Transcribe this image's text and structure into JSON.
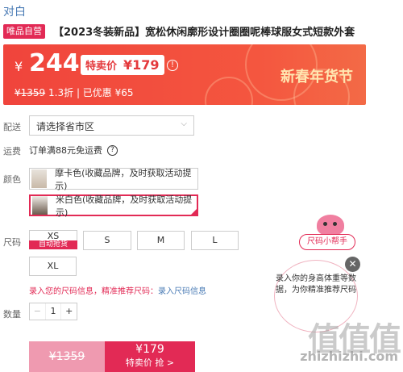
{
  "brand": "对白",
  "product": {
    "tag": "唯品自营",
    "title": "【2023冬装新品】宽松休闲廓形设计圈圈呢棒球服女式短款外套"
  },
  "price": {
    "currency": "¥",
    "current": "244",
    "special_label": "特卖价",
    "special_price": "¥179",
    "info_icon": "info-icon",
    "original": "¥1359",
    "discount": "1.3折",
    "saved": "已优惠 ¥65",
    "festival": "新春年货节"
  },
  "shipping": {
    "label": "配送",
    "placeholder": "请选择省市区",
    "fee_label": "运费",
    "fee_text": "订单满88元免运费"
  },
  "colors": {
    "label": "颜色",
    "options": [
      {
        "name": "摩卡色(收藏品牌，及时获取活动提示)",
        "selected": false
      },
      {
        "name": "米白色(收藏品牌，及时获取活动提示)",
        "selected": true
      }
    ]
  },
  "sizes": {
    "label": "尺码",
    "options": [
      "XS",
      "S",
      "M",
      "L",
      "XL"
    ],
    "xs_tag": "自动抢货",
    "tip": "录入您的尺码信息，精准推荐尺码：",
    "tip_link": "录入尺码信息"
  },
  "quantity": {
    "label": "数量",
    "value": "1",
    "minus": "−",
    "plus": "+"
  },
  "buttons": {
    "original_price": "¥1359",
    "special_price": "¥179",
    "special_text": "特卖价 抢 >"
  },
  "helper": {
    "title": "尺码小帮手",
    "message": "录入你的身高体重等数据，为你精准推荐尺码",
    "close": "✕"
  },
  "watermark": {
    "logo": "值值值",
    "site": "zhizhizhi.com"
  }
}
